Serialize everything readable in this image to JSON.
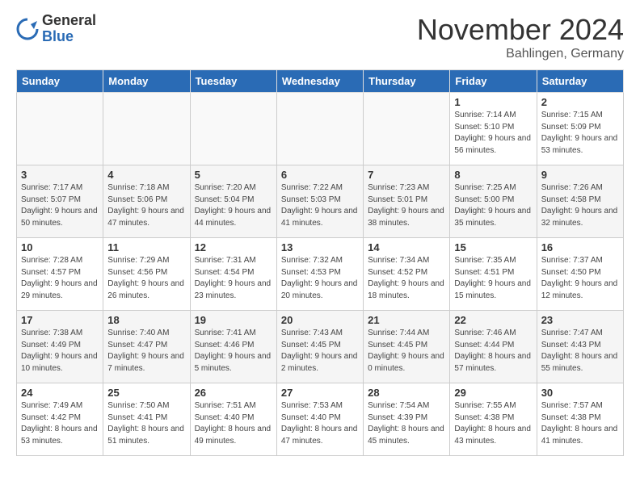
{
  "header": {
    "logo_general": "General",
    "logo_blue": "Blue",
    "title": "November 2024",
    "subtitle": "Bahlingen, Germany"
  },
  "weekdays": [
    "Sunday",
    "Monday",
    "Tuesday",
    "Wednesday",
    "Thursday",
    "Friday",
    "Saturday"
  ],
  "weeks": [
    [
      {
        "day": "",
        "info": ""
      },
      {
        "day": "",
        "info": ""
      },
      {
        "day": "",
        "info": ""
      },
      {
        "day": "",
        "info": ""
      },
      {
        "day": "",
        "info": ""
      },
      {
        "day": "1",
        "info": "Sunrise: 7:14 AM\nSunset: 5:10 PM\nDaylight: 9 hours and 56 minutes."
      },
      {
        "day": "2",
        "info": "Sunrise: 7:15 AM\nSunset: 5:09 PM\nDaylight: 9 hours and 53 minutes."
      }
    ],
    [
      {
        "day": "3",
        "info": "Sunrise: 7:17 AM\nSunset: 5:07 PM\nDaylight: 9 hours and 50 minutes."
      },
      {
        "day": "4",
        "info": "Sunrise: 7:18 AM\nSunset: 5:06 PM\nDaylight: 9 hours and 47 minutes."
      },
      {
        "day": "5",
        "info": "Sunrise: 7:20 AM\nSunset: 5:04 PM\nDaylight: 9 hours and 44 minutes."
      },
      {
        "day": "6",
        "info": "Sunrise: 7:22 AM\nSunset: 5:03 PM\nDaylight: 9 hours and 41 minutes."
      },
      {
        "day": "7",
        "info": "Sunrise: 7:23 AM\nSunset: 5:01 PM\nDaylight: 9 hours and 38 minutes."
      },
      {
        "day": "8",
        "info": "Sunrise: 7:25 AM\nSunset: 5:00 PM\nDaylight: 9 hours and 35 minutes."
      },
      {
        "day": "9",
        "info": "Sunrise: 7:26 AM\nSunset: 4:58 PM\nDaylight: 9 hours and 32 minutes."
      }
    ],
    [
      {
        "day": "10",
        "info": "Sunrise: 7:28 AM\nSunset: 4:57 PM\nDaylight: 9 hours and 29 minutes."
      },
      {
        "day": "11",
        "info": "Sunrise: 7:29 AM\nSunset: 4:56 PM\nDaylight: 9 hours and 26 minutes."
      },
      {
        "day": "12",
        "info": "Sunrise: 7:31 AM\nSunset: 4:54 PM\nDaylight: 9 hours and 23 minutes."
      },
      {
        "day": "13",
        "info": "Sunrise: 7:32 AM\nSunset: 4:53 PM\nDaylight: 9 hours and 20 minutes."
      },
      {
        "day": "14",
        "info": "Sunrise: 7:34 AM\nSunset: 4:52 PM\nDaylight: 9 hours and 18 minutes."
      },
      {
        "day": "15",
        "info": "Sunrise: 7:35 AM\nSunset: 4:51 PM\nDaylight: 9 hours and 15 minutes."
      },
      {
        "day": "16",
        "info": "Sunrise: 7:37 AM\nSunset: 4:50 PM\nDaylight: 9 hours and 12 minutes."
      }
    ],
    [
      {
        "day": "17",
        "info": "Sunrise: 7:38 AM\nSunset: 4:49 PM\nDaylight: 9 hours and 10 minutes."
      },
      {
        "day": "18",
        "info": "Sunrise: 7:40 AM\nSunset: 4:47 PM\nDaylight: 9 hours and 7 minutes."
      },
      {
        "day": "19",
        "info": "Sunrise: 7:41 AM\nSunset: 4:46 PM\nDaylight: 9 hours and 5 minutes."
      },
      {
        "day": "20",
        "info": "Sunrise: 7:43 AM\nSunset: 4:45 PM\nDaylight: 9 hours and 2 minutes."
      },
      {
        "day": "21",
        "info": "Sunrise: 7:44 AM\nSunset: 4:45 PM\nDaylight: 9 hours and 0 minutes."
      },
      {
        "day": "22",
        "info": "Sunrise: 7:46 AM\nSunset: 4:44 PM\nDaylight: 8 hours and 57 minutes."
      },
      {
        "day": "23",
        "info": "Sunrise: 7:47 AM\nSunset: 4:43 PM\nDaylight: 8 hours and 55 minutes."
      }
    ],
    [
      {
        "day": "24",
        "info": "Sunrise: 7:49 AM\nSunset: 4:42 PM\nDaylight: 8 hours and 53 minutes."
      },
      {
        "day": "25",
        "info": "Sunrise: 7:50 AM\nSunset: 4:41 PM\nDaylight: 8 hours and 51 minutes."
      },
      {
        "day": "26",
        "info": "Sunrise: 7:51 AM\nSunset: 4:40 PM\nDaylight: 8 hours and 49 minutes."
      },
      {
        "day": "27",
        "info": "Sunrise: 7:53 AM\nSunset: 4:40 PM\nDaylight: 8 hours and 47 minutes."
      },
      {
        "day": "28",
        "info": "Sunrise: 7:54 AM\nSunset: 4:39 PM\nDaylight: 8 hours and 45 minutes."
      },
      {
        "day": "29",
        "info": "Sunrise: 7:55 AM\nSunset: 4:38 PM\nDaylight: 8 hours and 43 minutes."
      },
      {
        "day": "30",
        "info": "Sunrise: 7:57 AM\nSunset: 4:38 PM\nDaylight: 8 hours and 41 minutes."
      }
    ]
  ]
}
